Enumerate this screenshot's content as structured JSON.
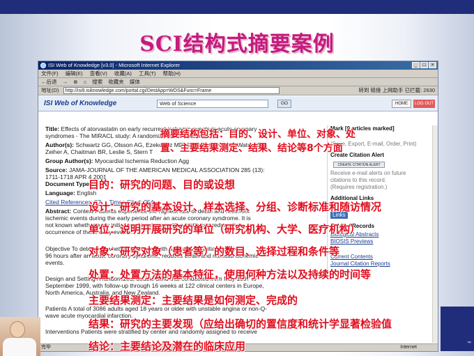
{
  "slide": {
    "title": "SCI结构式摘要案例"
  },
  "browser": {
    "window_title": "ISI Web of Knowledge [v3.0] - Microsoft Internet Explorer",
    "window_buttons": [
      "_",
      "□",
      "×"
    ],
    "menu": [
      "文件(F)",
      "编辑(E)",
      "查看(V)",
      "收藏(A)",
      "工具(T)",
      "帮助(H)"
    ],
    "toolbar": [
      "←后退",
      "→",
      "⊗",
      "⌂",
      "搜索",
      "收藏夹",
      "媒体"
    ],
    "address_label": "地址(D)",
    "address_url": "http://isi9.isiknowledge.com/portal.cgi/DestApp=WOS&Func=Frame",
    "go_label": "转到",
    "links_label": "链接",
    "extra_label": "上网助手",
    "blocked_label": "已拦截: 2630",
    "status_left": "完毕",
    "status_right": "Internet"
  },
  "wok": {
    "logo": "ISI Web of Knowledge",
    "database": "Web of Science",
    "go": "GO",
    "home": "HOME",
    "logout": "LOG OUT"
  },
  "record": {
    "title_label": "Title:",
    "title": "Effects of atorvastatin on early recurrent ischemic events in acute coronary",
    "title_cont": "syndromes - The MIRACL study: A randomized controlled trial",
    "authors_label": "Author(s):",
    "authors": "Schwartz GG, Olsson AG, Ezekowitz MD, Ganz P, Oliver MF, Waters D,",
    "authors_cont": "Zeiher A, Chaitman BR, Leslie S, Stern T",
    "group_label": "Group Author(s):",
    "group": "Myocardial Ischemia Reduction Agg",
    "source_label": "Source:",
    "source": "JAMA-JOURNAL OF THE AMERICAN MEDICAL ASSOCIATION 285 (13):",
    "source_cont": "1711-1718 APR 4 2001",
    "doctype_label": "Document Type:",
    "doctype": "Article",
    "language_label": "Language:",
    "language": "English",
    "cited_refs": "Cited References: 27",
    "times_cited": "Times Cited: 254",
    "abstract_label": "Abstract:",
    "abstract_lines": [
      "Context Patients experience the highest rate of death and recurrent",
      "ischemic events during the early period after an acute coronary syndrome. It is",
      "not known whether early initiation of treatment with a statin can reduce the",
      "occurrence of these early events.",
      "",
      "Objective To determine whether treatment with atorvastatin, initiated 24 to",
      "96 hours after an acute coronary syndrome, reduces death and nonfatal ischemic",
      "events.",
      "",
      "Design and Setting A randomized, double-blind trial conducted from May 1997 to",
      "September 1999, with follow-up through 16 weeks at 122 clinical centers in Europe,",
      "North America, Australia, and New Zealand.",
      "",
      "Patients A total of 3086 adults aged 18 years or older with unstable angina or non-Q-",
      "wave acute myocardial infarction.",
      "",
      "Interventions Patients were stratified by center and randomly assigned to receive"
    ]
  },
  "sidebar": {
    "marked": "Mark [0 articles marked]",
    "export": "(Save, Export, E-mail, Order, Print)",
    "alert_head": "Create Citation Alert",
    "alert_button": "CREATE CITATION ALERT",
    "alert_desc": [
      "Receive e-mail alerts on future",
      "citations to this record.",
      "(Requires registration.)"
    ],
    "links_head": "Additional Links",
    "links_button": "Links",
    "records_head": "Related Records",
    "link_items": [
      "Biological Abstracts",
      "BIOSIS Previews",
      "Current Contents",
      "Journal Citation Reports"
    ]
  },
  "annotations": [
    "摘要结构包括：目的、设计、单位、对象、处置、主要结果测定、结果、结论等8个方面",
    "目的：研究的问题、目的或设想",
    "设计：研究的基本设计、样本选择、分组、诊断标准和随访情况",
    "单位：说明开展研究的单位（研究机构、大学、医疗机构）",
    "对象：研究对象（患者等）的数目、选择过程和条件等",
    "处置：处置方法的基本特征，使用何种方法以及持续的时间等",
    "主要结果测定：主要结果是如何测定、完成的",
    "结果：研究的主要发现（应给出确切的置信度和统计学显著检验值",
    "结论：主要结论及潜在的临床应用"
  ],
  "colors": {
    "annotation": "#e10e1e",
    "title": "#c51b7d",
    "banner": "#1f2d7a"
  }
}
